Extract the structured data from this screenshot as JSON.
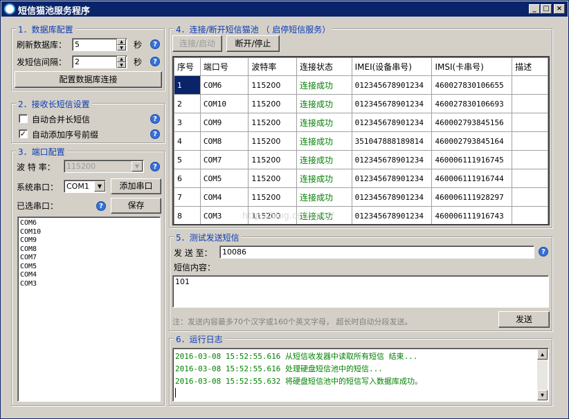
{
  "window": {
    "title": "短信猫池服务程序",
    "buttons": {
      "minimize": "_",
      "maximize": "□",
      "close": "×"
    }
  },
  "db": {
    "title": "1．数据库配置",
    "refresh_label": "刷新数据库：",
    "refresh_value": "5",
    "refresh_unit": "秒",
    "send_label": "发短信间隔：",
    "send_value": "2",
    "send_unit": "秒",
    "config_button": "配置数据库连接"
  },
  "long_sms": {
    "title": "2．接收长短信设置",
    "merge_label": "自动合并长短信",
    "merge_checked": false,
    "prefix_label": "自动添加序号前缀",
    "prefix_checked": true
  },
  "port": {
    "title": "3．端口配置",
    "baud_label": "波 特 率：",
    "baud_value": "115200",
    "serial_label": "系统串口：",
    "serial_value": "COM1",
    "add_button": "添加串口",
    "selected_label": "已选串口：",
    "save_button": "保存",
    "list": [
      "COM6",
      "COM10",
      "COM9",
      "COM8",
      "COM7",
      "COM5",
      "COM4",
      "COM3"
    ]
  },
  "pool": {
    "title": "4．连接/断开短信猫池 （ 启停短信服务）",
    "connect_button": "连接/启动",
    "disconnect_button": "断开/停止",
    "columns": [
      "序号",
      "端口号",
      "波特率",
      "连接状态",
      "IMEI(设备串号)",
      "IMSI(卡串号)",
      "描述"
    ],
    "rows": [
      {
        "no": "1",
        "port": "COM6",
        "baud": "115200",
        "status": "连接成功",
        "imei": "012345678901234",
        "imsi": "460027830106655",
        "desc": ""
      },
      {
        "no": "2",
        "port": "COM10",
        "baud": "115200",
        "status": "连接成功",
        "imei": "012345678901234",
        "imsi": "460027830106693",
        "desc": ""
      },
      {
        "no": "3",
        "port": "COM9",
        "baud": "115200",
        "status": "连接成功",
        "imei": "012345678901234",
        "imsi": "460002793845156",
        "desc": ""
      },
      {
        "no": "4",
        "port": "COM8",
        "baud": "115200",
        "status": "连接成功",
        "imei": "351047888189814",
        "imsi": "460002793845164",
        "desc": ""
      },
      {
        "no": "5",
        "port": "COM7",
        "baud": "115200",
        "status": "连接成功",
        "imei": "012345678901234",
        "imsi": "460006111916745",
        "desc": ""
      },
      {
        "no": "6",
        "port": "COM5",
        "baud": "115200",
        "status": "连接成功",
        "imei": "012345678901234",
        "imsi": "460006111916744",
        "desc": ""
      },
      {
        "no": "7",
        "port": "COM4",
        "baud": "115200",
        "status": "连接成功",
        "imei": "012345678901234",
        "imsi": "460006111928297",
        "desc": ""
      },
      {
        "no": "8",
        "port": "COM3",
        "baud": "115200",
        "status": "连接成功",
        "imei": "012345678901234",
        "imsi": "460006111916743",
        "desc": ""
      }
    ],
    "watermark": "http://blog.csdn.net/"
  },
  "test": {
    "title": "5．测试发送短信",
    "to_label": "发 送 至：",
    "to_value": "10086",
    "content_label": "短信内容：",
    "content_value": "101",
    "note": "注：发送内容最多70个汉字或160个英文字母， 超长时自动分段发送。",
    "send_button": "发送"
  },
  "logpanel": {
    "title": "6．运行日志",
    "lines": [
      "2016-03-08 15:52:55.616 从短信收发器中读取所有短信 结束...",
      "2016-03-08 15:52:55.616 处理硬盘短信池中的短信...",
      "2016-03-08 15:52:55.632 将硬盘短信池中的短信写入数据库成功。"
    ]
  },
  "colors": {
    "accent": "#0a246a",
    "group_title": "#0a3cb4",
    "success": "#008000"
  }
}
